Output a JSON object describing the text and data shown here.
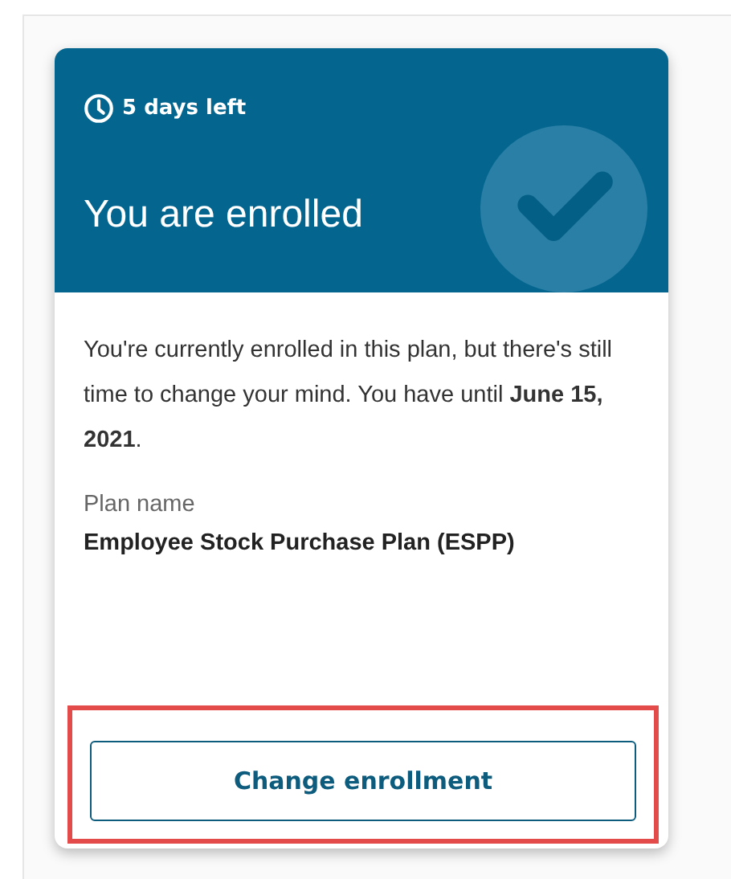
{
  "card": {
    "countdown": "5 days left",
    "title": "You are enrolled",
    "message": "You're currently enrolled in this plan, but there's still time to change your mind. You have until **June 15, 2021**.",
    "plan_label": "Plan name",
    "plan_name": "Employee Stock Purchase Plan (ESPP)",
    "button": {
      "label": "Change enrollment",
      "highlighted": true
    }
  }
}
